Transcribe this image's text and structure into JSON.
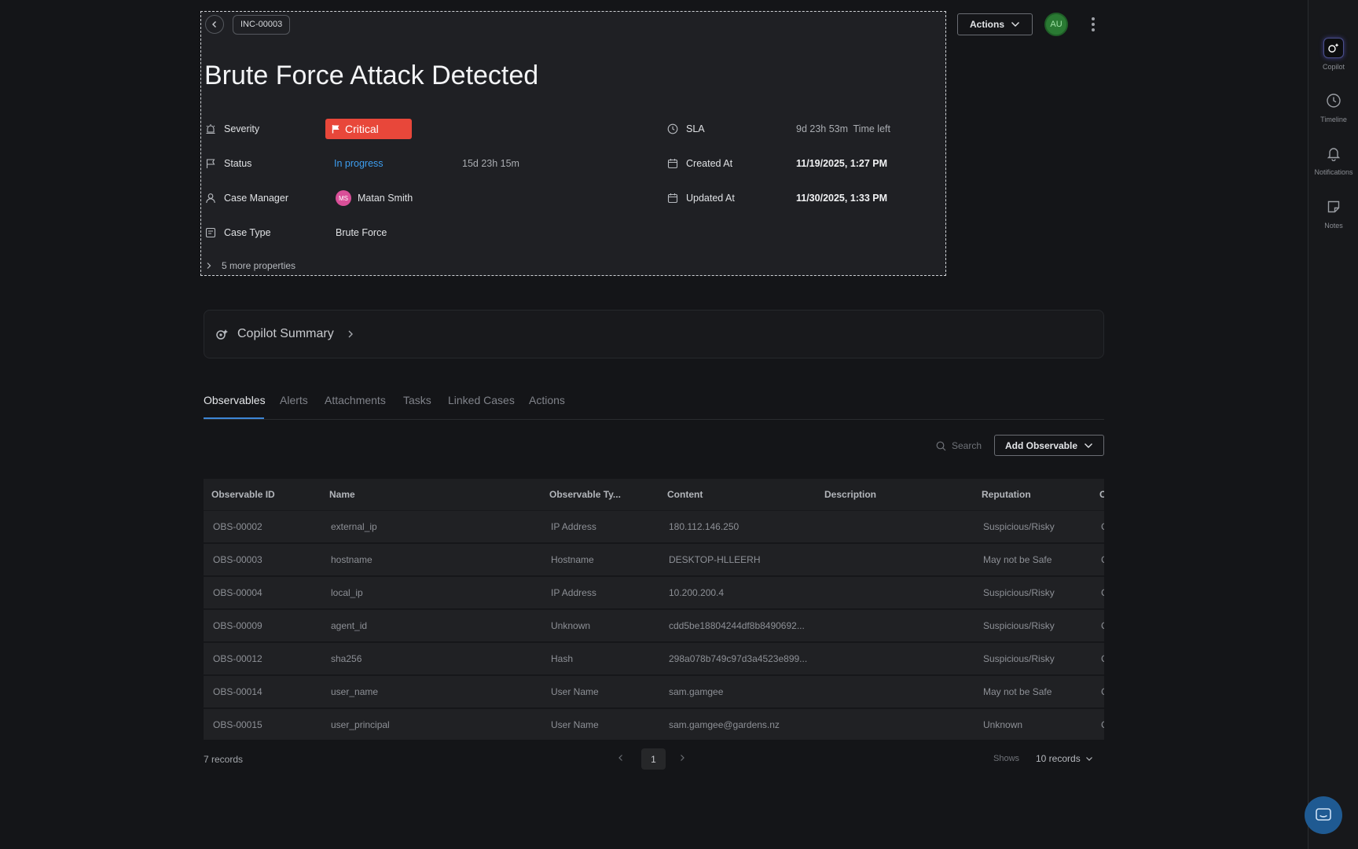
{
  "case": {
    "id": "INC-00003",
    "title": "Brute Force Attack Detected",
    "more_properties": "5 more properties"
  },
  "properties": {
    "severity_label": "Severity",
    "severity_value": "Critical",
    "severity_color": "#e8473a",
    "status_label": "Status",
    "status_value": "In progress",
    "status_duration": "15d 23h 15m",
    "case_manager_label": "Case Manager",
    "case_manager_initials": "MS",
    "case_manager_name": "Matan Smith",
    "case_type_label": "Case Type",
    "case_type_value": "Brute Force",
    "sla_label": "SLA",
    "sla_value": "9d 23h 53m",
    "sla_suffix": "Time left",
    "created_label": "Created At",
    "created_value": "11/19/2025, 1:27 PM",
    "updated_label": "Updated At",
    "updated_value": "11/30/2025, 1:33 PM"
  },
  "topbar": {
    "actions_label": "Actions",
    "user_initials": "AU"
  },
  "copilot_summary": {
    "label": "Copilot Summary"
  },
  "tabs": [
    {
      "label": "Observables",
      "active": true
    },
    {
      "label": "Alerts"
    },
    {
      "label": "Attachments"
    },
    {
      "label": "Tasks"
    },
    {
      "label": "Linked Cases"
    },
    {
      "label": "Actions"
    }
  ],
  "toolbar": {
    "search_placeholder": "Search",
    "add_label": "Add Observable"
  },
  "table": {
    "columns": [
      "Observable ID",
      "Name",
      "Observable Ty...",
      "Content",
      "Description",
      "Reputation",
      "C"
    ],
    "rows": [
      [
        "OBS-00002",
        "external_ip",
        "IP Address",
        "180.112.146.250",
        "",
        "Suspicious/Risky",
        "C"
      ],
      [
        "OBS-00003",
        "hostname",
        "Hostname",
        "DESKTOP-HLLEERH",
        "",
        "May not be Safe",
        "C"
      ],
      [
        "OBS-00004",
        "local_ip",
        "IP Address",
        "10.200.200.4",
        "",
        "Suspicious/Risky",
        "C"
      ],
      [
        "OBS-00009",
        "agent_id",
        "Unknown",
        "cdd5be18804244df8b8490692...",
        "",
        "Suspicious/Risky",
        "C"
      ],
      [
        "OBS-00012",
        "sha256",
        "Hash",
        "298a078b749c97d3a4523e899...",
        "",
        "Suspicious/Risky",
        "C"
      ],
      [
        "OBS-00014",
        "user_name",
        "User Name",
        "sam.gamgee",
        "",
        "May not be Safe",
        "C"
      ],
      [
        "OBS-00015",
        "user_principal",
        "User Name",
        "sam.gamgee@gardens.nz",
        "",
        "Unknown",
        "C"
      ]
    ]
  },
  "footer": {
    "records": "7 records",
    "page": "1",
    "shows_label": "Shows",
    "per_page": "10 records"
  },
  "rail": [
    {
      "label": "Copilot",
      "icon": "copilot-icon"
    },
    {
      "label": "Timeline",
      "icon": "clock-icon"
    },
    {
      "label": "Notifications",
      "icon": "bell-icon"
    },
    {
      "label": "Notes",
      "icon": "note-icon"
    }
  ]
}
